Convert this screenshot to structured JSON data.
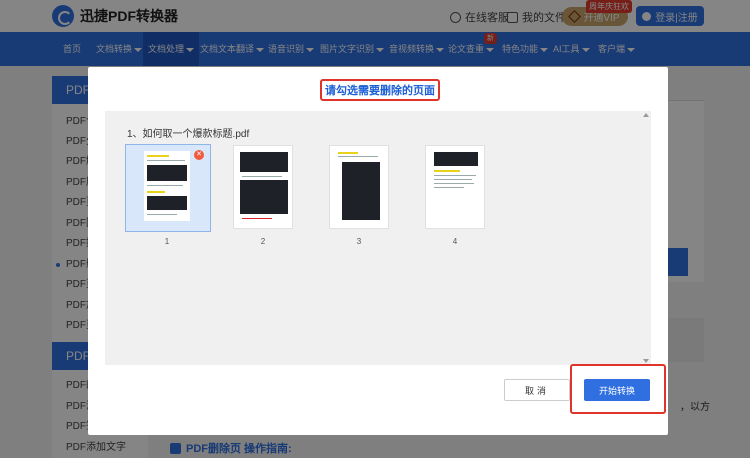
{
  "app": {
    "title": "迅捷PDF转换器"
  },
  "topbar": {
    "service": "在线客服",
    "my_files": "我的文件",
    "vip_label": "开通VIP",
    "vip_badge": "周年庆狂欢",
    "login": "登录|注册"
  },
  "nav": {
    "items": [
      {
        "label": "首页",
        "has_caret": false
      },
      {
        "label": "文档转换",
        "has_caret": true
      },
      {
        "label": "文档处理",
        "has_caret": true,
        "active": true
      },
      {
        "label": "文档文本翻译",
        "has_caret": true
      },
      {
        "label": "语音识别",
        "has_caret": true
      },
      {
        "label": "图片文字识别",
        "has_caret": true
      },
      {
        "label": "音视频转换",
        "has_caret": true
      },
      {
        "label": "论文查重",
        "has_caret": true,
        "badge": "新"
      },
      {
        "label": "特色功能",
        "has_caret": true
      },
      {
        "label": "AI工具",
        "has_caret": true
      },
      {
        "label": "客户端",
        "has_caret": true
      }
    ]
  },
  "sidebar": {
    "sections": [
      {
        "title": "PDF处理",
        "items": [
          "PDF合",
          "PDF分",
          "PDF解",
          "PDF压",
          "PDF页",
          "PDF图",
          "PDF提",
          "PDF删",
          "PDF页",
          "PDF加",
          "PDF页"
        ]
      },
      {
        "title": "PDF编辑",
        "items": [
          "PDF翻",
          "PDF添",
          "PDF签",
          "PDF添加文字"
        ]
      }
    ],
    "active_index": 7
  },
  "background": {
    "partial_text": "，以方",
    "guide": "PDF删除页 操作指南:"
  },
  "modal": {
    "title": "请勾选需要删除的页面",
    "file_label": "1、如何取一个爆款标题.pdf",
    "pages": [
      {
        "number": "1",
        "selected": true
      },
      {
        "number": "2",
        "selected": false
      },
      {
        "number": "3",
        "selected": false
      },
      {
        "number": "4",
        "selected": false
      }
    ],
    "close_glyph": "✕",
    "cancel": "取消",
    "start": "开始转换"
  },
  "colors": {
    "primary": "#2f6fe0",
    "highlight_red": "#e0332a",
    "vip_gold": "#c9a46a"
  }
}
